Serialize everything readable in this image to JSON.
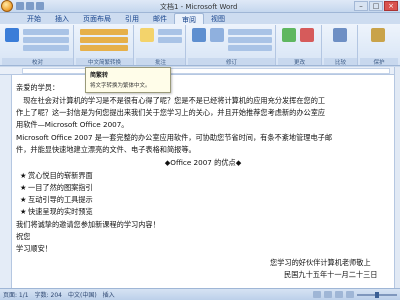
{
  "title": "文档1 - Microsoft Word",
  "tabs": [
    "开始",
    "插入",
    "页面布局",
    "引用",
    "邮件",
    "审阅",
    "视图"
  ],
  "active_tab_index": 5,
  "ribbon_groups": [
    "校对",
    "中文简繁转换",
    "批注",
    "修订",
    "更改",
    "比较",
    "保护"
  ],
  "ribbon_buttons": {
    "spelling": "拼写和语法",
    "research": "信息检索",
    "thesaurus": "同义词库",
    "translate": "翻译",
    "to_simplified": "繁转简",
    "to_traditional": "简转繁",
    "convert": "简繁转换",
    "new_comment": "新建批注",
    "track_changes": "修订",
    "accept": "接受",
    "compare": "比较",
    "protect": "保护文档"
  },
  "tooltip": {
    "title": "简繁转",
    "description": "将文字转换为繁体中文。"
  },
  "document": {
    "greeting": "亲爱的学员：",
    "paragraph1_line1": "　现在社会对计算机的学习是不是很有心得了呢？您是不是已经将计算机的应用充分发挥在您的工",
    "paragraph1_line2": "作上了呢？这一封信是为何您提出来我们关于您学习上的关心，并且开始推荐您考虑新的办公室应",
    "paragraph1_line3": "用软件—Microsoft Office 2007。",
    "paragraph2_line1": "Microsoft Office 2007 是一套完整的办公室应用软件，可协助您节省时间，有条不紊地管理电子邮",
    "paragraph2_line2": "件，并能显快速地建立漂亮的文件、电子表格和简报等。",
    "heading": "Office 2007 的优点",
    "bullets": [
      "赏心悦目的崭新界面",
      "一目了然的图案指引",
      "互动引导的工具提示",
      "快速呈现的实时预览"
    ],
    "closing1": "我们将诚挚的邀请您参加新课程的学习内容！",
    "closing2": "祝您",
    "closing3": "学习顺安！",
    "signature": "您学习的好伙伴计算机老师敬上",
    "date": "民国九十五年十一月二十三日"
  },
  "status": {
    "page": "页面: 1/1",
    "words": "字数: 204",
    "lang": "中文(中国)",
    "mode": "插入"
  }
}
